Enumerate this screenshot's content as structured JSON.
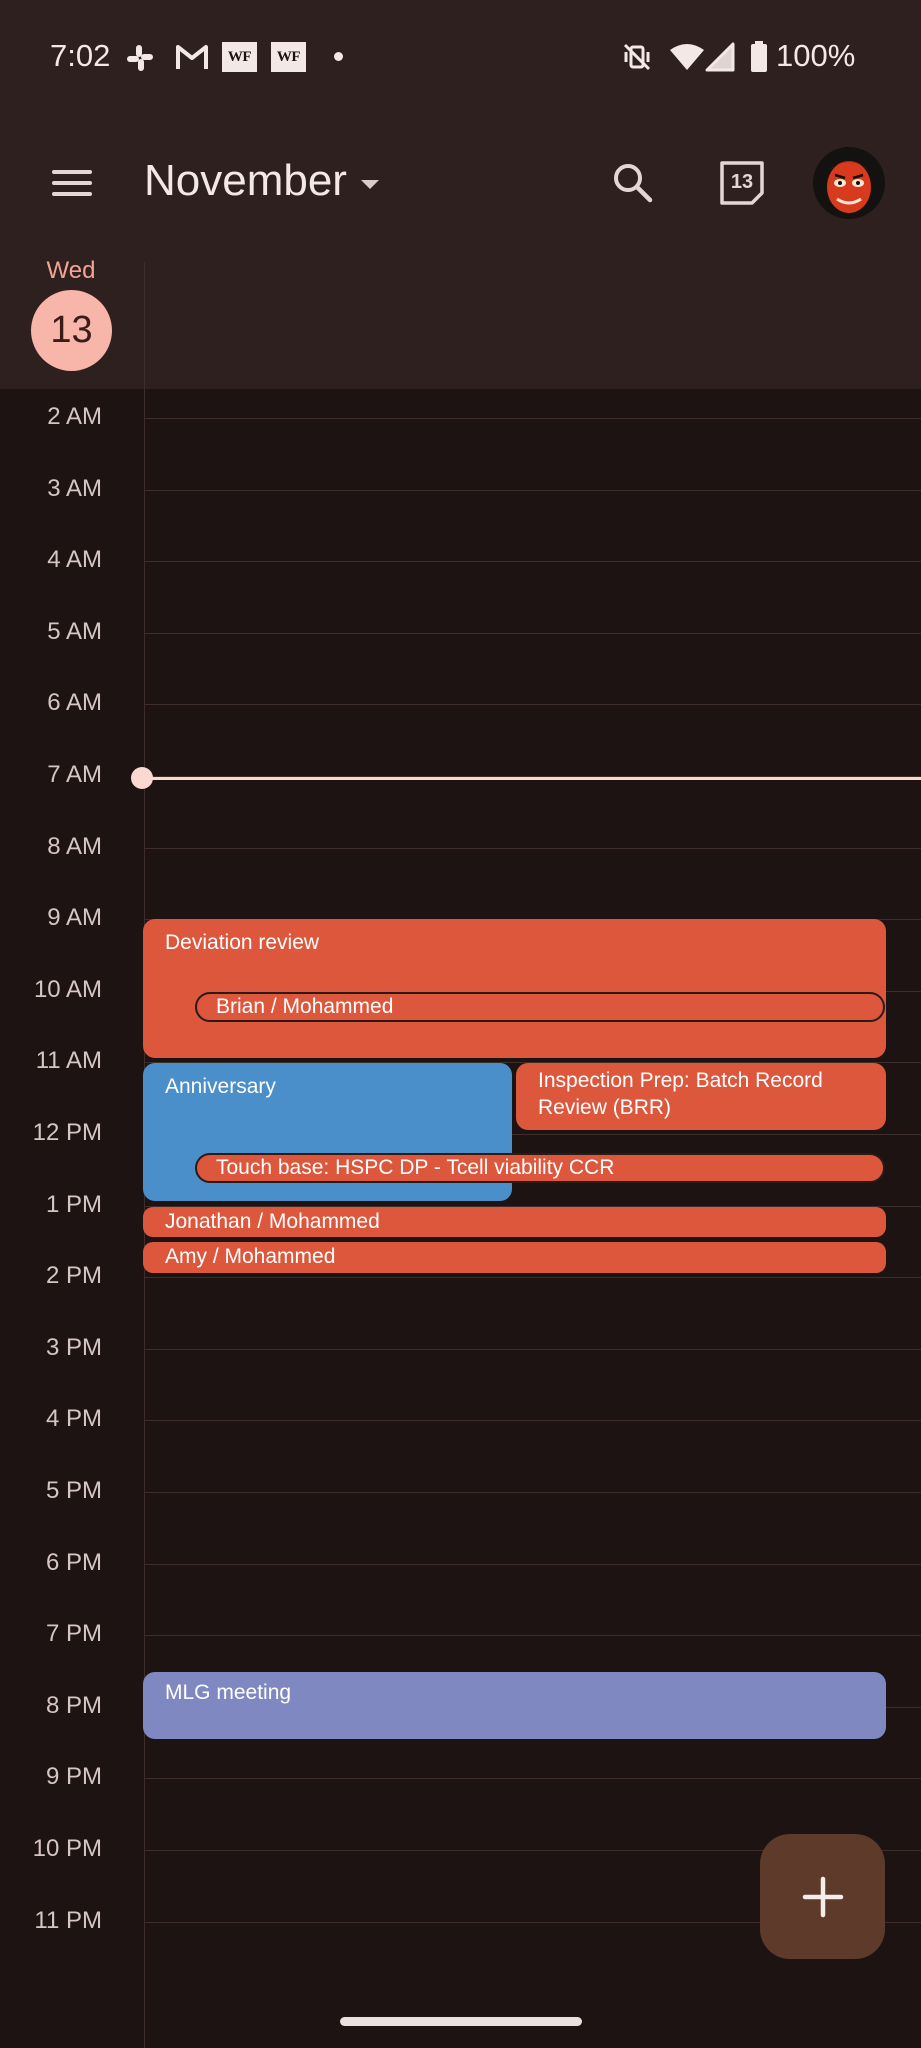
{
  "status_bar": {
    "time": "7:02",
    "notif_icons": [
      "slack-icon",
      "gmail-icon",
      "wf-app-icon",
      "wf-app-icon",
      "more-dot-icon"
    ],
    "wf_label": "WF",
    "system_icons": [
      "vibrate-off-icon",
      "wifi-icon",
      "signal-icon",
      "battery-icon"
    ],
    "battery": "100%"
  },
  "app_bar": {
    "month": "November",
    "today_date": "13",
    "menu_icon": "menu-icon",
    "search_icon": "search-icon",
    "today_icon": "calendar-today-icon"
  },
  "day_header": {
    "day_name": "Wed",
    "day_number": "13"
  },
  "hours": [
    "2 AM",
    "3 AM",
    "4 AM",
    "5 AM",
    "6 AM",
    "7 AM",
    "8 AM",
    "9 AM",
    "10 AM",
    "11 AM",
    "12 PM",
    "1 PM",
    "2 PM",
    "3 PM",
    "4 PM",
    "5 PM",
    "6 PM",
    "7 PM",
    "8 PM",
    "9 PM",
    "10 PM",
    "11 PM"
  ],
  "events": {
    "deviation_review": "Deviation review",
    "brian_mohammed": "Brian / Mohammed",
    "anniversary": "Anniversary",
    "inspection_prep": "Inspection Prep: Batch Record Review (BRR)",
    "touch_base": "Touch base: HSPC DP - Tcell viability CCR",
    "jonathan_mohammed": "Jonathan / Mohammed",
    "amy_mohammed": "Amy / Mohammed",
    "mlg_meeting": "MLG meeting"
  },
  "colors": {
    "event_red": "#dd573c",
    "event_blue": "#4b8fca",
    "event_lavender": "#7f88c1",
    "today_circle": "#f8b5a9",
    "fab": "#5d3a2a"
  },
  "fab_icon": "plus-icon"
}
